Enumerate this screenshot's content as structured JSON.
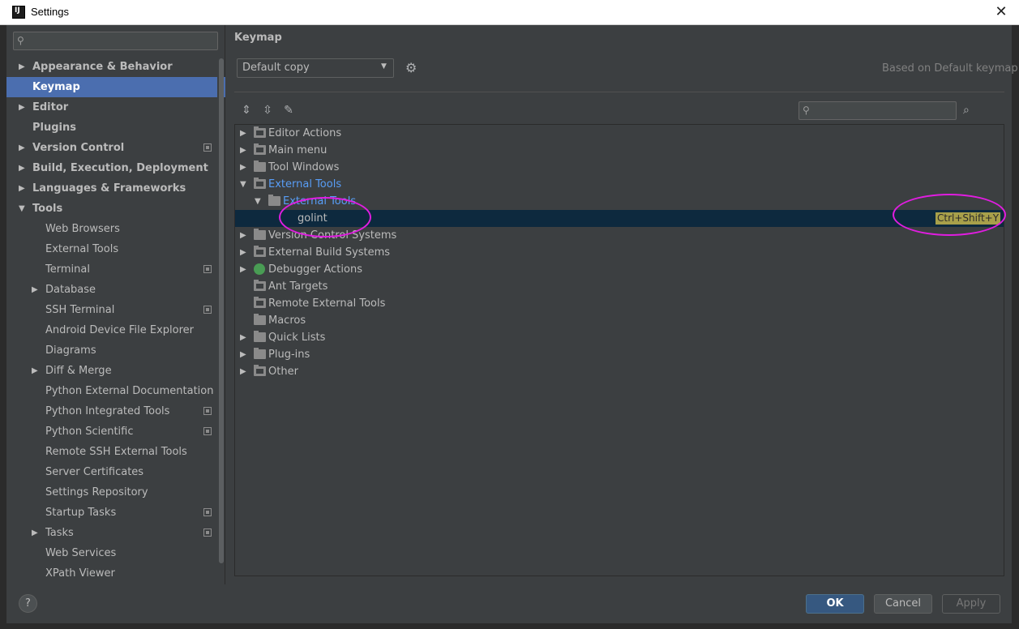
{
  "window": {
    "title": "Settings"
  },
  "sidebar": {
    "search_placeholder": "",
    "items": [
      {
        "label": "Appearance & Behavior",
        "arrow": "right",
        "bold": true,
        "level": 0
      },
      {
        "label": "Keymap",
        "arrow": "none",
        "bold": true,
        "level": 0,
        "selected": true
      },
      {
        "label": "Editor",
        "arrow": "right",
        "bold": true,
        "level": 0
      },
      {
        "label": "Plugins",
        "arrow": "none",
        "bold": true,
        "level": 0
      },
      {
        "label": "Version Control",
        "arrow": "right",
        "bold": true,
        "level": 0,
        "project": true
      },
      {
        "label": "Build, Execution, Deployment",
        "arrow": "right",
        "bold": true,
        "level": 0
      },
      {
        "label": "Languages & Frameworks",
        "arrow": "right",
        "bold": true,
        "level": 0
      },
      {
        "label": "Tools",
        "arrow": "down",
        "bold": true,
        "level": 0
      },
      {
        "label": "Web Browsers",
        "arrow": "none",
        "level": 1
      },
      {
        "label": "External Tools",
        "arrow": "none",
        "level": 1
      },
      {
        "label": "Terminal",
        "arrow": "none",
        "level": 1,
        "project": true
      },
      {
        "label": "Database",
        "arrow": "right",
        "level": 1
      },
      {
        "label": "SSH Terminal",
        "arrow": "none",
        "level": 1,
        "project": true
      },
      {
        "label": "Android Device File Explorer",
        "arrow": "none",
        "level": 1
      },
      {
        "label": "Diagrams",
        "arrow": "none",
        "level": 1
      },
      {
        "label": "Diff & Merge",
        "arrow": "right",
        "level": 1
      },
      {
        "label": "Python External Documentation",
        "arrow": "none",
        "level": 1
      },
      {
        "label": "Python Integrated Tools",
        "arrow": "none",
        "level": 1,
        "project": true
      },
      {
        "label": "Python Scientific",
        "arrow": "none",
        "level": 1,
        "project": true
      },
      {
        "label": "Remote SSH External Tools",
        "arrow": "none",
        "level": 1
      },
      {
        "label": "Server Certificates",
        "arrow": "none",
        "level": 1
      },
      {
        "label": "Settings Repository",
        "arrow": "none",
        "level": 1
      },
      {
        "label": "Startup Tasks",
        "arrow": "none",
        "level": 1,
        "project": true
      },
      {
        "label": "Tasks",
        "arrow": "right",
        "level": 1,
        "project": true
      },
      {
        "label": "Web Services",
        "arrow": "none",
        "level": 1
      },
      {
        "label": "XPath Viewer",
        "arrow": "none",
        "level": 1
      }
    ]
  },
  "main": {
    "title": "Keymap",
    "keymap_value": "Default copy",
    "based_on": "Based on Default keymap",
    "tree_search_placeholder": "",
    "tree": [
      {
        "label": "Editor Actions",
        "arrow": "right",
        "level": 0,
        "icon": "tool-folder-icon"
      },
      {
        "label": "Main menu",
        "arrow": "right",
        "level": 0,
        "icon": "tool-folder-icon"
      },
      {
        "label": "Tool Windows",
        "arrow": "right",
        "level": 0,
        "icon": "folder-icon"
      },
      {
        "label": "External Tools",
        "arrow": "down",
        "level": 0,
        "icon": "tool-folder-icon",
        "blue": true
      },
      {
        "label": "External Tools",
        "arrow": "down",
        "level": 1,
        "icon": "folder-icon",
        "blue": true
      },
      {
        "label": "golint",
        "arrow": "none",
        "level": 2,
        "icon": "none",
        "selected": true,
        "shortcut": "Ctrl+Shift+Y"
      },
      {
        "label": "Version Control Systems",
        "arrow": "right",
        "level": 0,
        "icon": "folder-icon"
      },
      {
        "label": "External Build Systems",
        "arrow": "right",
        "level": 0,
        "icon": "tool-folder-icon"
      },
      {
        "label": "Debugger Actions",
        "arrow": "right",
        "level": 0,
        "icon": "bug-icon"
      },
      {
        "label": "Ant Targets",
        "arrow": "none",
        "level": 0,
        "icon": "tool-folder-icon"
      },
      {
        "label": "Remote External Tools",
        "arrow": "none",
        "level": 0,
        "icon": "tool-folder-icon"
      },
      {
        "label": "Macros",
        "arrow": "none",
        "level": 0,
        "icon": "folder-icon"
      },
      {
        "label": "Quick Lists",
        "arrow": "right",
        "level": 0,
        "icon": "folder-icon"
      },
      {
        "label": "Plug-ins",
        "arrow": "right",
        "level": 0,
        "icon": "folder-icon"
      },
      {
        "label": "Other",
        "arrow": "right",
        "level": 0,
        "icon": "tool-folder-icon"
      }
    ]
  },
  "footer": {
    "help": "?",
    "ok": "OK",
    "cancel": "Cancel",
    "apply": "Apply"
  },
  "colors": {
    "selection": "#4b6eaf",
    "tree_selection": "#0d293e",
    "shortcut_bg": "#a8a04a",
    "annotation": "#e01de0",
    "link_blue": "#589df6"
  }
}
